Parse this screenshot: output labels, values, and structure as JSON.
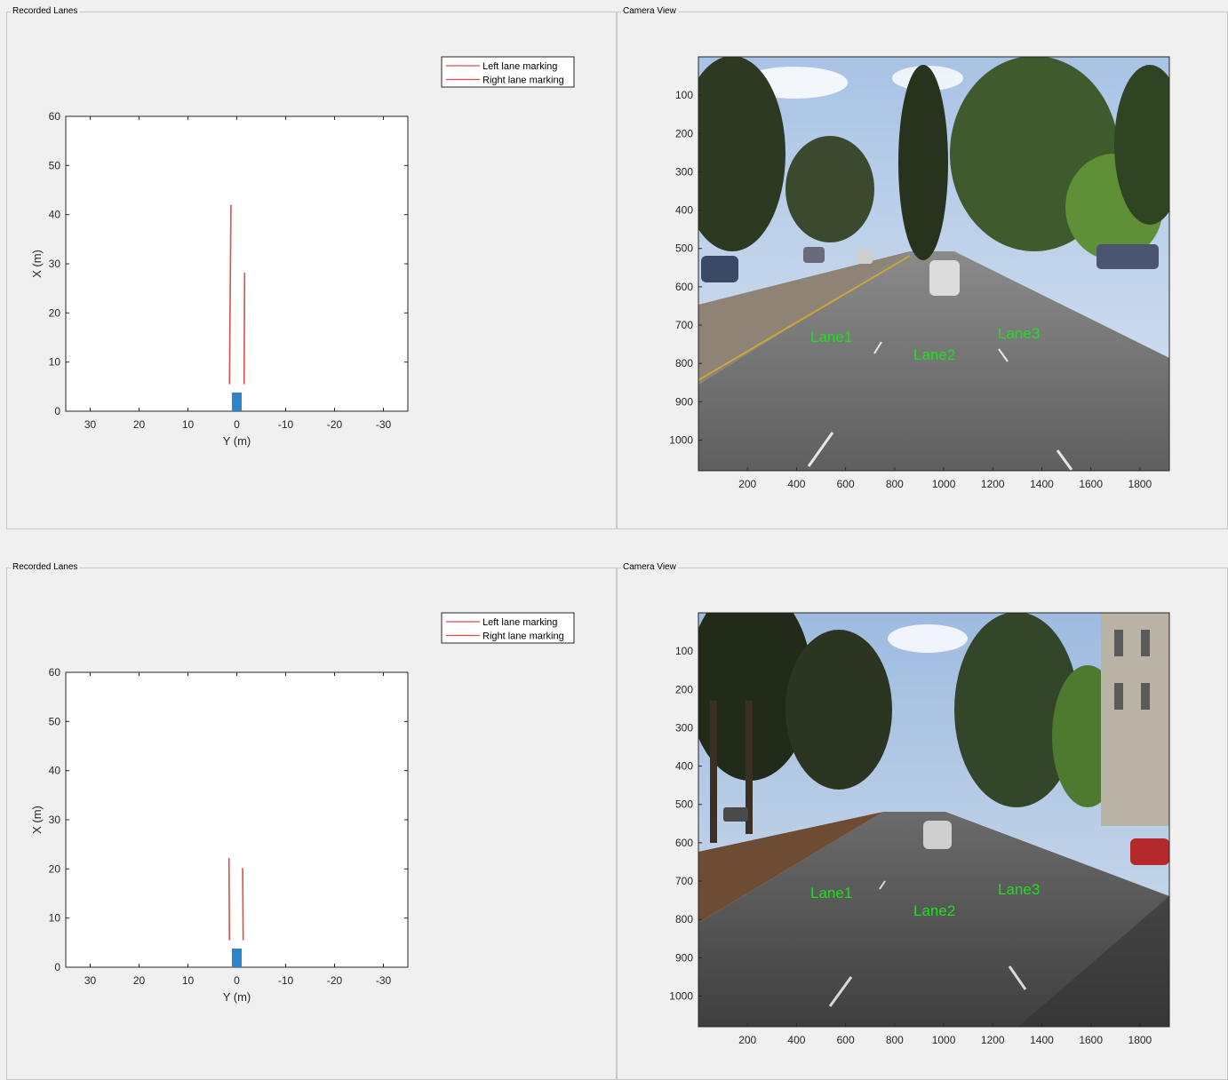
{
  "colors": {
    "background": "#f0f0f0",
    "lane_marking": "#e34a4a",
    "ego_vehicle": "#2f83c8",
    "overlay_text": "#22dd22"
  },
  "rows": [
    {
      "recorded_lanes": {
        "title": "Recorded Lanes",
        "legend": [
          "Left lane marking",
          "Right lane marking"
        ],
        "xlabel": "Y (m)",
        "ylabel": "X (m)"
      },
      "camera_view": {
        "title": "Camera View",
        "lane_labels": [
          "Lane1",
          "Lane2",
          "Lane3"
        ]
      }
    },
    {
      "recorded_lanes": {
        "title": "Recorded Lanes",
        "legend": [
          "Left lane marking",
          "Right lane marking"
        ],
        "xlabel": "Y (m)",
        "ylabel": "X (m)"
      },
      "camera_view": {
        "title": "Camera View",
        "lane_labels": [
          "Lane1",
          "Lane2",
          "Lane3"
        ]
      }
    }
  ],
  "chart_data": [
    {
      "type": "line",
      "xlabel": "Y (m)",
      "ylabel": "X (m)",
      "xlim": [
        35,
        -35
      ],
      "ylim": [
        0,
        60
      ],
      "xticks": [
        30,
        20,
        10,
        0,
        -10,
        -20,
        -30
      ],
      "yticks": [
        0,
        10,
        20,
        30,
        40,
        50,
        60
      ],
      "legend_position": "top-right (outside)",
      "series": [
        {
          "name": "Left lane marking",
          "x": [
            1.5,
            1.2
          ],
          "y": [
            5.5,
            42
          ]
        },
        {
          "name": "Right lane marking",
          "x": [
            -1.5,
            -1.6
          ],
          "y": [
            5.5,
            28.2
          ]
        }
      ],
      "ego_vehicle": {
        "y_range": [
          -1,
          1
        ],
        "x_range": [
          0,
          3.8
        ]
      }
    },
    {
      "type": "line",
      "xlabel": "Y (m)",
      "ylabel": "X (m)",
      "xlim": [
        35,
        -35
      ],
      "ylim": [
        0,
        60
      ],
      "xticks": [
        30,
        20,
        10,
        0,
        -10,
        -20,
        -30
      ],
      "yticks": [
        0,
        10,
        20,
        30,
        40,
        50,
        60
      ],
      "legend_position": "top-right (outside)",
      "series": [
        {
          "name": "Left lane marking",
          "x": [
            1.5,
            1.6
          ],
          "y": [
            5.5,
            22.2
          ]
        },
        {
          "name": "Right lane marking",
          "x": [
            -1.3,
            -1.2
          ],
          "y": [
            5.5,
            20.2
          ]
        }
      ],
      "ego_vehicle": {
        "y_range": [
          -1,
          1
        ],
        "x_range": [
          0,
          3.8
        ]
      }
    },
    {
      "type": "image",
      "xlim": [
        0,
        1920
      ],
      "ylim": [
        1080,
        0
      ],
      "xticks": [
        200,
        400,
        600,
        800,
        1000,
        1200,
        1400,
        1600,
        1800
      ],
      "yticks": [
        100,
        200,
        300,
        400,
        500,
        600,
        700,
        800,
        900,
        1000
      ]
    },
    {
      "type": "image",
      "xlim": [
        0,
        1920
      ],
      "ylim": [
        1080,
        0
      ],
      "xticks": [
        200,
        400,
        600,
        800,
        1000,
        1200,
        1400,
        1600,
        1800
      ],
      "yticks": [
        100,
        200,
        300,
        400,
        500,
        600,
        700,
        800,
        900,
        1000
      ]
    }
  ]
}
